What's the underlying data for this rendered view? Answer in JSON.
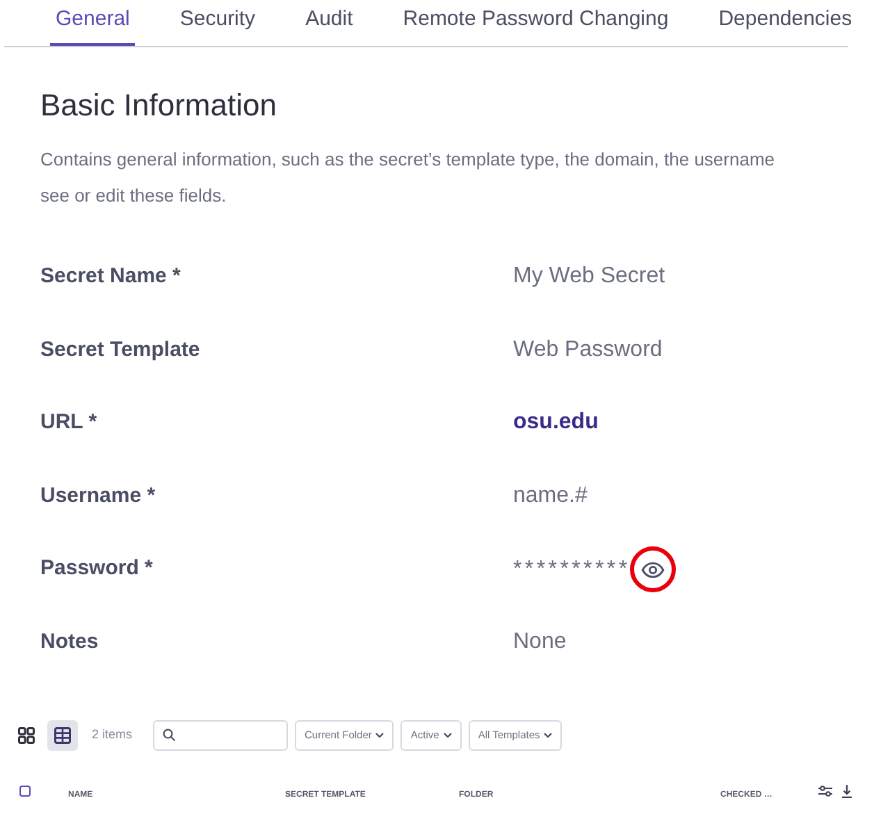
{
  "tabs": [
    {
      "label": "General",
      "selected": true
    },
    {
      "label": "Security",
      "selected": false
    },
    {
      "label": "Audit",
      "selected": false
    },
    {
      "label": "Remote Password Changing",
      "selected": false
    },
    {
      "label": "Dependencies",
      "selected": false
    }
  ],
  "section": {
    "title": "Basic Information",
    "description": [
      "Contains general information, such as the secret’s template type, the domain, the username",
      "see or edit these fields."
    ]
  },
  "fields": [
    {
      "label": "Secret Name *",
      "value": "My Web Secret",
      "kind": "text"
    },
    {
      "label": "Secret Template",
      "value": "Web Password",
      "kind": "text"
    },
    {
      "label": "URL *",
      "value": "osu.edu",
      "kind": "link"
    },
    {
      "label": "Username *",
      "value": "name.#",
      "kind": "text"
    },
    {
      "label": "Password *",
      "value": "**********",
      "kind": "password",
      "reveal_highlighted": true
    },
    {
      "label": "Notes",
      "value": "None",
      "kind": "text"
    }
  ],
  "toolbar": {
    "views": [
      {
        "kind": "grid",
        "selected": false
      },
      {
        "kind": "table",
        "selected": true
      }
    ],
    "count": "2 items",
    "filters": [
      {
        "label": "Current Folder"
      },
      {
        "label": "Active"
      },
      {
        "label": "All Templates"
      }
    ]
  },
  "table": {
    "select_all": {
      "checked": false
    },
    "columns": [
      "NAME",
      "SECRET TEMPLATE",
      "FOLDER",
      "CHECKED …"
    ]
  }
}
